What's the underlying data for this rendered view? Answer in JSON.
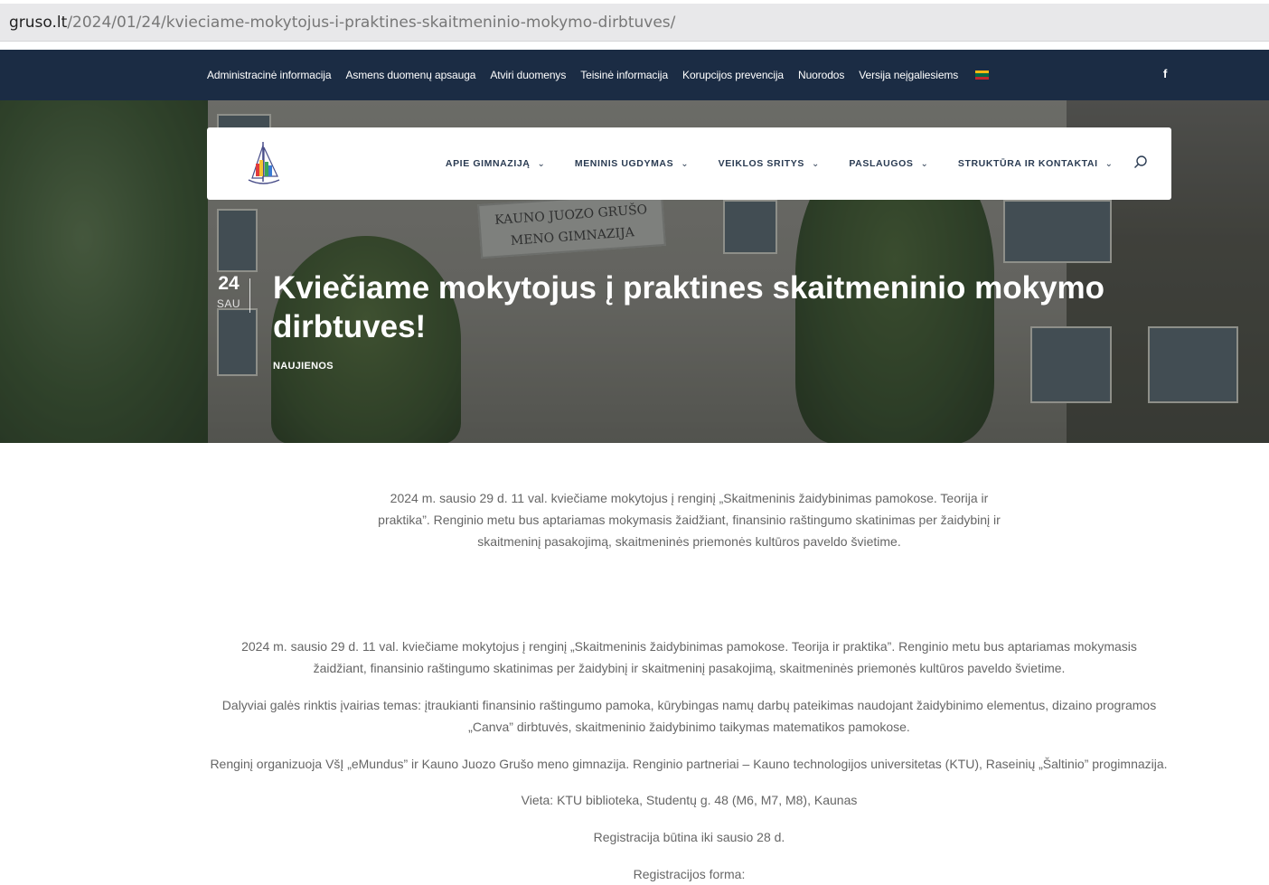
{
  "browser": {
    "url_domain": "gruso.lt",
    "url_path": "/2024/01/24/kvieciame-mokytojus-i-praktines-skaitmeninio-mokymo-dirbtuves/"
  },
  "topbar": {
    "links": [
      "Administracinė informacija",
      "Asmens duomenų apsauga",
      "Atviri duomenys",
      "Teisinė informacija",
      "Korupcijos prevencija",
      "Nuorodos",
      "Versija neįgaliesiems"
    ],
    "flag_colors": [
      "#fdb913",
      "#006a44",
      "#c1272d"
    ],
    "social_icon": "facebook-icon",
    "social_label": "f"
  },
  "nav": {
    "items": [
      {
        "label": "APIE GIMNAZIJĄ"
      },
      {
        "label": "MENINIS UGDYMAS"
      },
      {
        "label": "VEIKLOS SRITYS"
      },
      {
        "label": "PASLAUGOS"
      },
      {
        "label": "STRUKTŪRA IR KONTAKTAI"
      }
    ],
    "chevron": "⌄",
    "search_icon": "search-icon"
  },
  "hero": {
    "sign_line1": "KAUNO JUOZO GRUŠO",
    "sign_line2": "MENO GIMNAZIJA",
    "date_day": "24",
    "date_month": "SAU",
    "title": "Kviečiame mokytojus į praktines skaitmeninio mokymo dirbtuves!",
    "category": "NAUJIENOS"
  },
  "content": {
    "intro": "2024 m. sausio 29 d. 11 val. kviečiame mokytojus į renginį „Skaitmeninis žaidybinimas pamokose. Teorija ir praktika”. Renginio metu bus aptariamas mokymasis žaidžiant, finansinio raštingumo skatinimas per žaidybinį ir skaitmeninį pasakojimą, skaitmeninės priemonės kultūros paveldo švietime.",
    "p1": "2024 m. sausio 29 d. 11 val. kviečiame mokytojus į renginį „Skaitmeninis žaidybinimas pamokose. Teorija ir praktika”. Renginio metu bus aptariamas mokymasis žaidžiant, finansinio raštingumo skatinimas per žaidybinį ir skaitmeninį pasakojimą, skaitmeninės priemonės kultūros paveldo švietime.",
    "p2": "Dalyviai galės rinktis įvairias temas: įtraukianti finansinio raštingumo pamoka, kūrybingas namų darbų pateikimas naudojant žaidybinimo elementus, dizaino programos „Canva” dirbtuvės, skaitmeninio žaidybinimo taikymas matematikos pamokose.",
    "p3": "Renginį organizuoja VšĮ „eMundus” ir Kauno Juozo Grušo meno gimnazija. Renginio partneriai – Kauno technologijos universitetas (KTU), Raseinių „Šaltinio” progimnazija.",
    "p4": "Vieta: KTU biblioteka, Studentų g. 48 (M6, M7, M8), Kaunas",
    "p5": "Registracija būtina iki sausio 28 d.",
    "p6": "Registracijos forma:"
  }
}
